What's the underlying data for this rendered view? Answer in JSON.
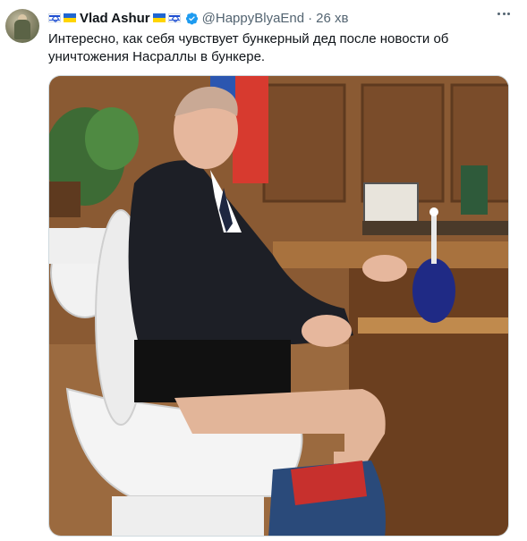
{
  "tweet": {
    "author": {
      "display_name": "Vlad Ashur",
      "handle": "@HappyBlyaEnd",
      "prefix_flags": [
        "israel-flag",
        "ukraine-flag"
      ],
      "suffix_flags": [
        "ukraine-flag",
        "israel-flag"
      ],
      "verified_icon": "verified-badge-icon",
      "verified_color": "#1d9bf0"
    },
    "separator": "·",
    "time": "26 хв",
    "text": "Интересно, как себя чувствует бункерный дед после новости об уничтожения Насраллы в бункере.",
    "more_icon": "more-dots-icon",
    "media": {
      "type": "photo"
    }
  }
}
